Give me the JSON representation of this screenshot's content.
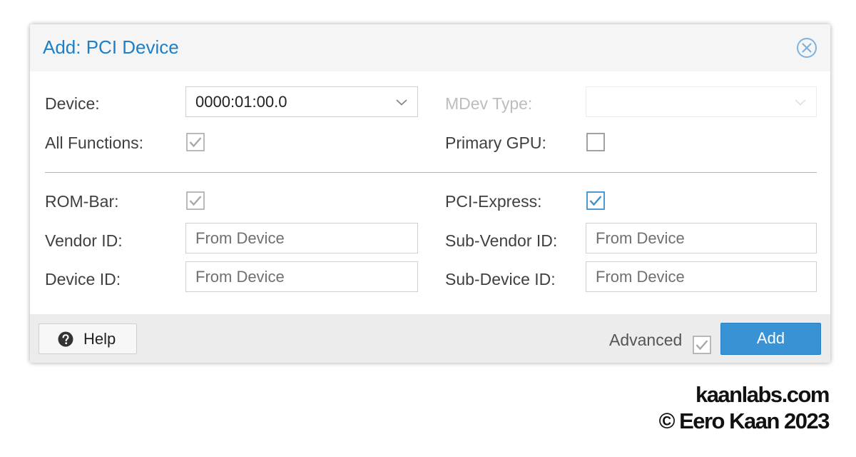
{
  "dialog": {
    "title": "Add: PCI Device",
    "close_icon": "close-circle-icon"
  },
  "form": {
    "device": {
      "label": "Device:",
      "value": "0000:01:00.0"
    },
    "mdev_type": {
      "label": "MDev Type:",
      "value": "",
      "disabled": true
    },
    "all_functions": {
      "label": "All Functions:",
      "checked": true,
      "disabled": true
    },
    "primary_gpu": {
      "label": "Primary GPU:",
      "checked": false
    },
    "rom_bar": {
      "label": "ROM-Bar:",
      "checked": true,
      "disabled": true
    },
    "pci_express": {
      "label": "PCI-Express:",
      "checked": true
    },
    "vendor_id": {
      "label": "Vendor ID:",
      "placeholder": "From Device"
    },
    "sub_vendor_id": {
      "label": "Sub-Vendor ID:",
      "placeholder": "From Device"
    },
    "device_id": {
      "label": "Device ID:",
      "placeholder": "From Device"
    },
    "sub_device_id": {
      "label": "Sub-Device ID:",
      "placeholder": "From Device"
    }
  },
  "footer": {
    "help_label": "Help",
    "help_icon": "question-circle-icon",
    "advanced_label": "Advanced",
    "advanced_checked": true,
    "add_label": "Add"
  },
  "watermark": {
    "site": "kaanlabs.com",
    "copyright": "© Eero Kaan 2023"
  },
  "colors": {
    "accent": "#1c7fc8",
    "button": "#3892d4",
    "check_active": "#3a8fd0",
    "check_disabled": "#a8a8a8"
  }
}
